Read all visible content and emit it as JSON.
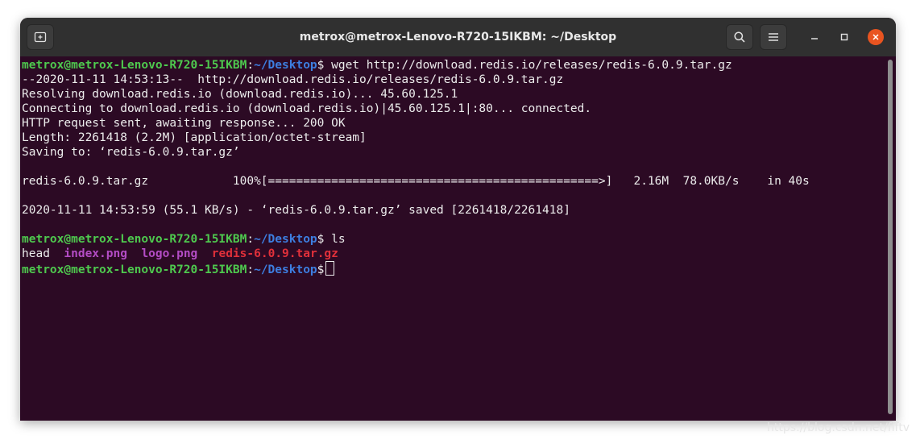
{
  "window": {
    "title": "metrox@metrox-Lenovo-R720-15IKBM: ~/Desktop"
  },
  "titlebar": {
    "new_tab_icon": "new-tab-icon",
    "search_icon": "search-icon",
    "menu_icon": "hamburger-menu-icon",
    "minimize_icon": "minimize-icon",
    "maximize_icon": "maximize-icon",
    "close_icon": "close-icon"
  },
  "colors": {
    "terminal_bg": "#2c0a24",
    "titlebar_bg": "#303030",
    "user_host": "#4ec94e",
    "path": "#3d7ee0",
    "image_file": "#b34cc4",
    "archive_file": "#e0303a",
    "close_button": "#e95420"
  },
  "prompt": {
    "user_host": "metrox@metrox-Lenovo-R720-15IKBM",
    "colon": ":",
    "path": "~/Desktop",
    "dollar": "$"
  },
  "terminal": {
    "cmd1": " wget http://download.redis.io/releases/redis-6.0.9.tar.gz",
    "out": [
      "--2020-11-11 14:53:13--  http://download.redis.io/releases/redis-6.0.9.tar.gz",
      "Resolving download.redis.io (download.redis.io)... 45.60.125.1",
      "Connecting to download.redis.io (download.redis.io)|45.60.125.1|:80... connected.",
      "HTTP request sent, awaiting response... 200 OK",
      "Length: 2261418 (2.2M) [application/octet-stream]",
      "Saving to: ‘redis-6.0.9.tar.gz’",
      "",
      "redis-6.0.9.tar.gz            100%[===============================================>]   2.16M  78.0KB/s    in 40s",
      "",
      "2020-11-11 14:53:59 (55.1 KB/s) - ‘redis-6.0.9.tar.gz’ saved [2261418/2261418]",
      ""
    ],
    "cmd2": " ls",
    "ls_files": {
      "head": "head",
      "index": "index.png",
      "logo": "logo.png",
      "archive": "redis-6.0.9.tar.gz"
    }
  },
  "watermark": "https://blog.csdn.net/fiftv"
}
